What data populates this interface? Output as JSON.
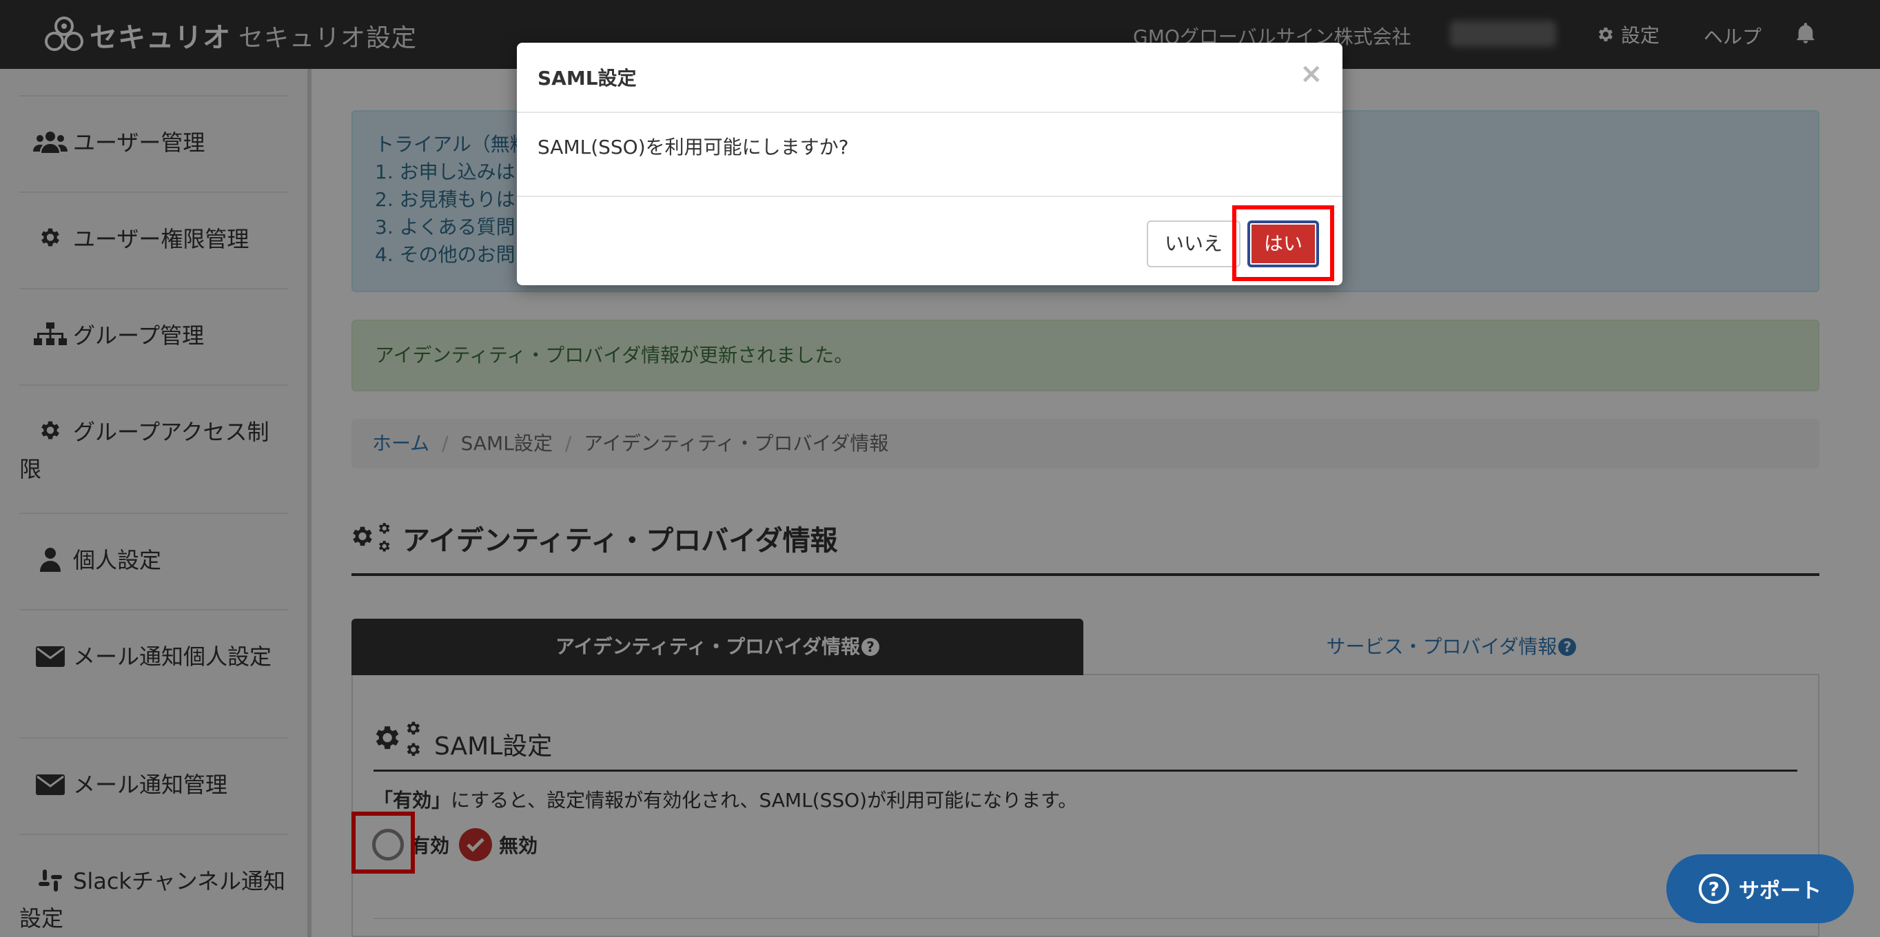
{
  "header": {
    "logo_text": "セキュリオ",
    "app_title": "セキュリオ設定",
    "company": "GMOグローバルサイン株式会社",
    "settings_label": "設定",
    "help_label": "ヘルプ"
  },
  "sidebar": {
    "items": [
      {
        "label": "ユーザー管理",
        "icon": "users-icon"
      },
      {
        "label": "ユーザー権限管理",
        "icon": "gear-icon"
      },
      {
        "label": "グループ管理",
        "icon": "sitemap-icon"
      },
      {
        "label": "グループアクセス制限",
        "icon": "gear-icon"
      },
      {
        "label": "個人設定",
        "icon": "user-icon"
      },
      {
        "label": "メール通知個人設定",
        "icon": "envelope-icon"
      },
      {
        "label": "メール通知管理",
        "icon": "envelope-icon"
      },
      {
        "label": "Slackチャンネル通知設定",
        "icon": "slack-icon"
      }
    ]
  },
  "alerts": {
    "info_lines": [
      "トライアル（無料",
      "1. お申し込みは",
      "2. お見積もりは",
      "3. よくある質問",
      "4. その他のお問"
    ],
    "success": "アイデンティティ・プロバイダ情報が更新されました。"
  },
  "breadcrumb": {
    "home": "ホーム",
    "saml": "SAML設定",
    "current": "アイデンティティ・プロバイダ情報"
  },
  "page": {
    "title": "アイデンティティ・プロバイダ情報"
  },
  "tabs": {
    "active": "アイデンティティ・プロバイダ情報",
    "inactive": "サービス・プロバイダ情報"
  },
  "section": {
    "title": "SAML設定",
    "desc_bold": "「有効」",
    "desc_rest": "にすると、設定情報が有効化され、SAML(SSO)が利用可能になります。",
    "option_enabled": "有効",
    "option_disabled": "無効",
    "selected": "無効"
  },
  "support": {
    "label": "サポート"
  },
  "modal": {
    "title": "SAML設定",
    "close": "×",
    "body": "SAML(SSO)を利用可能にしますか?",
    "no_label": "いいえ",
    "yes_label": "はい"
  },
  "colors": {
    "header_bg": "#343434",
    "danger": "#c9302c",
    "link": "#337ab7",
    "highlight": "#ff0000"
  }
}
